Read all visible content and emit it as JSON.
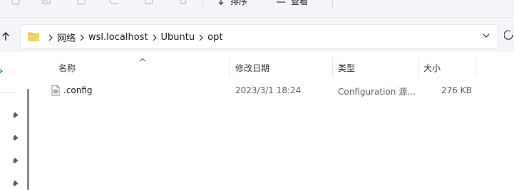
{
  "toolbar": {
    "sort_label": "排序",
    "view_label": "查看"
  },
  "breadcrumb": {
    "items": [
      "网络",
      "wsl.localhost",
      "Ubuntu",
      "opt"
    ]
  },
  "columns": {
    "name": "名称",
    "modified": "修改日期",
    "type": "类型",
    "size": "大小"
  },
  "files": [
    {
      "name": ".config",
      "modified": "2023/3/1 18:24",
      "type": "Configuration 源...",
      "size": "276 KB"
    }
  ],
  "colors": {
    "accent": "#0067c0",
    "folder": "#f0c24f",
    "toolbar_bg": "#f3f5f9"
  }
}
